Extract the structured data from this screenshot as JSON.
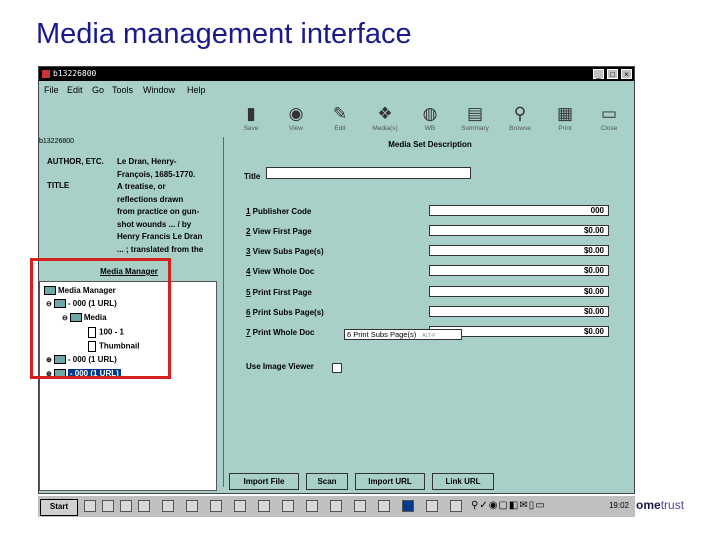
{
  "slide_title": "Media management interface",
  "window": {
    "title": "b13226800",
    "buttons": [
      "_",
      "□",
      "×"
    ]
  },
  "menu": [
    "File",
    "Edit",
    "Go",
    "Tools",
    "Window",
    "Help"
  ],
  "toolbar": [
    {
      "label": "Save",
      "icon": "floppy-icon",
      "glyph": "▮"
    },
    {
      "label": "View",
      "icon": "eye-icon",
      "glyph": "◉"
    },
    {
      "label": "Edit",
      "icon": "edit-icon",
      "glyph": "✎"
    },
    {
      "label": "Media(s)",
      "icon": "media-icon",
      "glyph": "❖"
    },
    {
      "label": "WB",
      "icon": "globe-icon",
      "glyph": "◍"
    },
    {
      "label": "Summary",
      "icon": "summary-icon",
      "glyph": "▤"
    },
    {
      "label": "Browse",
      "icon": "magnifier-icon",
      "glyph": "⚲"
    },
    {
      "label": "Print",
      "icon": "printer-icon",
      "glyph": "▦"
    },
    {
      "label": "Close",
      "icon": "close-doc-icon",
      "glyph": "▭"
    }
  ],
  "record": {
    "id": "b13226800",
    "author_label": "AUTHOR, ETC.",
    "author_lines": [
      "Le Dran, Henry-",
      "François, 1685-1770."
    ],
    "title_label": "TITLE",
    "title_lines": [
      "A treatise, or",
      "reflections drawn",
      "from practice on gun-",
      "shot wounds ... / by",
      "Henry Francis Le Dran",
      "... ; translated from the"
    ]
  },
  "media_manager": {
    "title": "Media Manager",
    "nodes": {
      "root": "Media Manager",
      "n1": "- 000 (1 URL)",
      "media": "Media",
      "item": "100 - 1",
      "thumb": "Thumbnail",
      "n2": "- 000 (1 URL)",
      "n3": "- 000 (1 URL)"
    }
  },
  "description": {
    "title": "Media Set Description",
    "title_label": "Title",
    "title_value": "",
    "fields": [
      {
        "num": "1",
        "label": " Publisher Code",
        "value": "000"
      },
      {
        "num": "2",
        "label": " View First Page",
        "value": "$0.00"
      },
      {
        "num": "3",
        "label": " View Subs Page(s)",
        "value": "$0.00"
      },
      {
        "num": "4",
        "label": " View Whole Doc",
        "value": "$0.00"
      },
      {
        "num": "5",
        "label": " Print First Page",
        "value": "$0.00"
      },
      {
        "num": "6",
        "label": " Print Subs Page(s)",
        "value": "$0.00"
      },
      {
        "num": "7",
        "label": " Print Whole Doc",
        "value": "$0.00"
      }
    ],
    "tooltip": "6 Print Subs Page(s)",
    "tooltip_small": "ALT-F",
    "use_viewer": "Use Image Viewer"
  },
  "buttons": [
    "Import File",
    "Scan",
    "Import URL",
    "Link URL"
  ],
  "taskbar": {
    "start": "Start",
    "time": "19:02",
    "tray_glyphs": "⚲✓◉▢◧✉▯▭"
  },
  "logo": {
    "bold": "ome",
    "rest": "trust"
  }
}
